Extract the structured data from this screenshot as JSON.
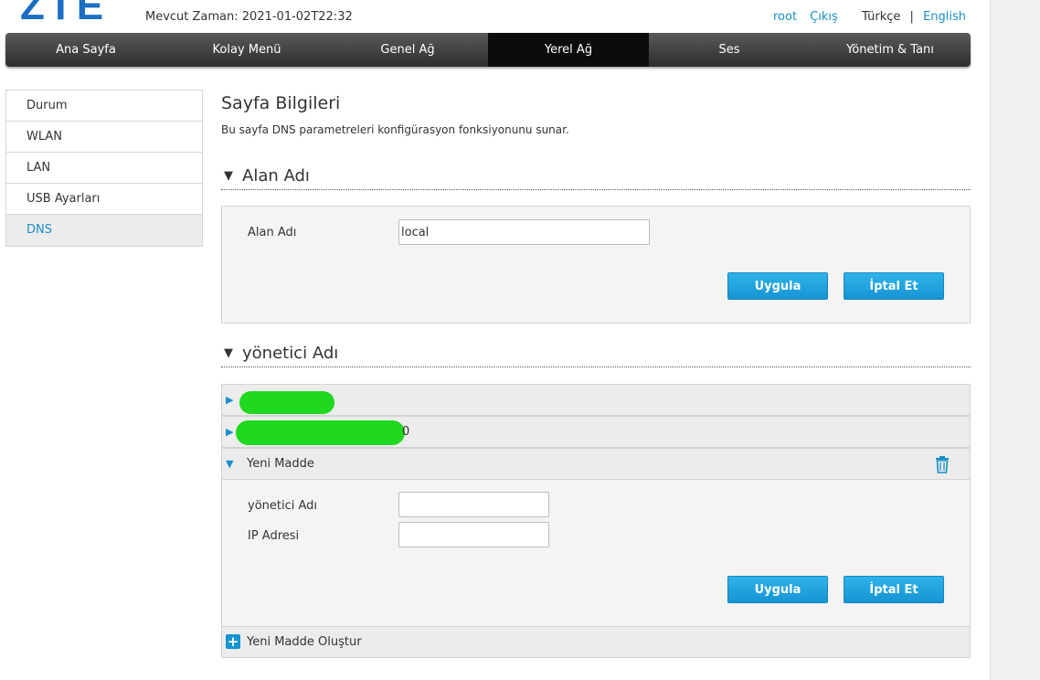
{
  "header": {
    "logo": "ZTE",
    "time_label": "Mevcut Zaman: 2021-01-02T22:32",
    "user": "root",
    "logout": "Çıkış",
    "lang_current": "Türkçe",
    "lang_separator": "|",
    "lang_other": "English"
  },
  "nav": {
    "items": [
      {
        "label": "Ana Sayfa"
      },
      {
        "label": "Kolay Menü"
      },
      {
        "label": "Genel Ağ"
      },
      {
        "label": "Yerel Ağ"
      },
      {
        "label": "Ses"
      },
      {
        "label": "Yönetim & Tanı"
      }
    ],
    "active": "Yerel Ağ"
  },
  "sidebar": {
    "items": [
      {
        "label": "Durum"
      },
      {
        "label": "WLAN"
      },
      {
        "label": "LAN"
      },
      {
        "label": "USB Ayarları"
      },
      {
        "label": "DNS"
      }
    ],
    "active": "DNS"
  },
  "page": {
    "title": "Sayfa Bilgileri",
    "description": "Bu sayfa DNS parametreleri konfigürasyon fonksiyonunu sunar."
  },
  "domain_section": {
    "title": "Alan Adı",
    "field_label": "Alan Adı",
    "field_value": "local",
    "apply_label": "Uygula",
    "cancel_label": "İptal Et"
  },
  "host_section": {
    "title": "yönetici Adı",
    "rows": [
      {
        "suffix": ""
      },
      {
        "suffix": "0"
      }
    ],
    "new_item": {
      "title": "Yeni Madde",
      "host_label": "yönetici Adı",
      "host_value": "",
      "ip_label": "IP Adresi",
      "ip_value": "",
      "apply_label": "Uygula",
      "cancel_label": "İptal Et"
    },
    "create_label": "Yeni Madde Oluştur"
  },
  "colors": {
    "accent": "#1a8fc9",
    "button": "#1594d2",
    "navbar": "#2d2d2d",
    "redaction": "#1fd81f"
  },
  "icons": {
    "collapse": "triangle-down",
    "expand": "triangle-right",
    "delete": "trash-icon",
    "add": "plus-icon"
  }
}
